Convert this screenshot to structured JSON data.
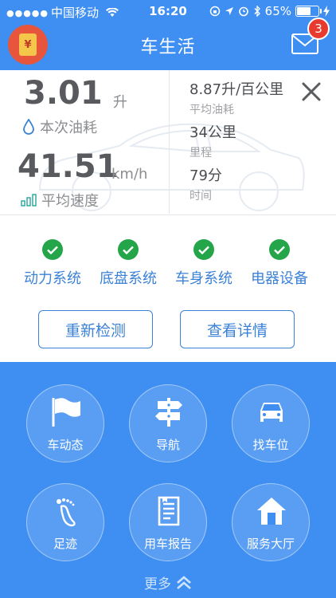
{
  "status_bar": {
    "signal": "●●●●●",
    "carrier": "中国移动",
    "time": "16:20",
    "battery": "65%",
    "battery_level": 0.65
  },
  "header": {
    "title": "车生活",
    "packet_symbol": "¥",
    "mail_badge": "3"
  },
  "trip": {
    "fuel": {
      "value": "3.01",
      "unit": "升",
      "label": "本次油耗"
    },
    "speed": {
      "value": "41.51",
      "unit": "km/h",
      "label": "平均速度"
    },
    "avg_fuel": {
      "value": "8.87升/百公里",
      "label": "平均油耗"
    },
    "distance": {
      "value": "34公里",
      "label": "里程"
    },
    "duration": {
      "value": "79分",
      "label": "时间"
    }
  },
  "systems": [
    {
      "label": "动力系统",
      "ok": true
    },
    {
      "label": "底盘系统",
      "ok": true
    },
    {
      "label": "车身系统",
      "ok": true
    },
    {
      "label": "电器设备",
      "ok": true
    }
  ],
  "actions": {
    "recheck": "重新检测",
    "details": "查看详情"
  },
  "grid": [
    {
      "label": "车动态",
      "icon": "flag-icon"
    },
    {
      "label": "导航",
      "icon": "signpost-icon"
    },
    {
      "label": "找车位",
      "icon": "car-icon"
    },
    {
      "label": "足迹",
      "icon": "footprint-icon"
    },
    {
      "label": "用车报告",
      "icon": "report-icon"
    },
    {
      "label": "服务大厅",
      "icon": "house-icon"
    }
  ],
  "more": "更多",
  "colors": {
    "primary": "#3f8ff2",
    "check": "#25a54a",
    "accent_text": "#3b82d6",
    "badge": "#e8392f"
  }
}
